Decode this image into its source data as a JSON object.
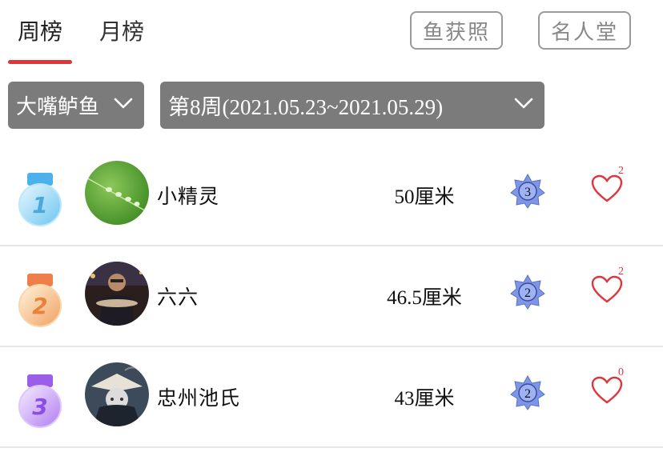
{
  "tabs": [
    {
      "label": "周榜",
      "active": true
    },
    {
      "label": "月榜",
      "active": false
    }
  ],
  "header_buttons": {
    "catch_photo": "鱼获照",
    "hall_of_fame": "名人堂"
  },
  "filters": {
    "species": "大嘴鲈鱼",
    "week": "第8周(2021.05.23~2021.05.29)"
  },
  "colors": {
    "accent": "#e0353b",
    "dropdown_bg": "#7b7b7b",
    "medal_1": "#6cc4ef",
    "medal_2": "#f0a060",
    "medal_3": "#b27ef0"
  },
  "rankings": [
    {
      "rank": "1",
      "name": "小精灵",
      "size": "50厘米",
      "level": "3",
      "likes": "2",
      "avatar": "avatar-water-droplets"
    },
    {
      "rank": "2",
      "name": "六六",
      "size": "46.5厘米",
      "level": "2",
      "likes": "2",
      "avatar": "avatar-man-holding-fish"
    },
    {
      "rank": "3",
      "name": "忠州池氏",
      "size": "43厘米",
      "level": "2",
      "likes": "0",
      "avatar": "avatar-cartoon-character"
    }
  ]
}
